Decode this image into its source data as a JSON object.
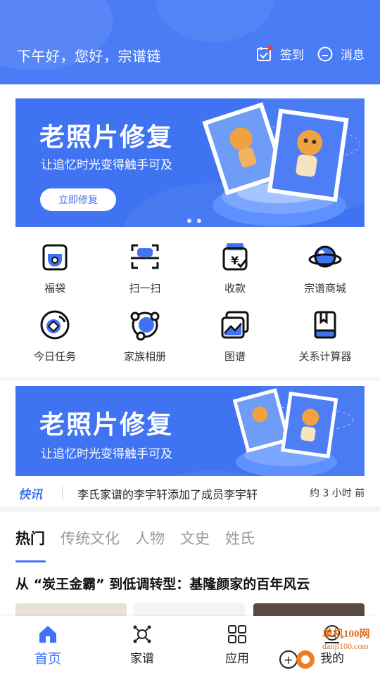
{
  "header": {
    "greeting": "下午好，您好，宗谱链",
    "checkin_label": "签到",
    "message_label": "消息"
  },
  "banner_top": {
    "title": "老照片修复",
    "subtitle": "让追忆时光变得触手可及",
    "button_label": "立即修复"
  },
  "grid": [
    {
      "label": "福袋",
      "icon": "lucky-bag-icon"
    },
    {
      "label": "扫一扫",
      "icon": "scan-icon"
    },
    {
      "label": "收款",
      "icon": "payment-icon"
    },
    {
      "label": "宗谱商城",
      "icon": "planet-icon"
    },
    {
      "label": "今日任务",
      "icon": "task-icon"
    },
    {
      "label": "家族相册",
      "icon": "album-icon"
    },
    {
      "label": "图谱",
      "icon": "image-icon"
    },
    {
      "label": "关系计算器",
      "icon": "book-icon"
    }
  ],
  "banner_mid": {
    "title": "老照片修复",
    "subtitle": "让追忆时光变得触手可及"
  },
  "news": {
    "tag": "快讯",
    "text": "李氏家谱的李宇轩添加了成员李宇轩",
    "time": "约 3 小时 前"
  },
  "tabs": [
    "热门",
    "传统文化",
    "人物",
    "文史",
    "姓氏"
  ],
  "article": {
    "title": "从 “炭王金霸” 到低调转型：基隆颜家的百年风云"
  },
  "tabbar": [
    {
      "label": "首页",
      "icon": "home-icon"
    },
    {
      "label": "家谱",
      "icon": "network-icon"
    },
    {
      "label": "应用",
      "icon": "apps-icon"
    },
    {
      "label": "我的",
      "icon": "profile-icon"
    }
  ],
  "watermark": {
    "line1": "单机100网",
    "line2": "danji100.com"
  },
  "colors": {
    "primary": "#4a7cf6",
    "accent": "#3f73f2",
    "badge": "#f03c3c"
  }
}
